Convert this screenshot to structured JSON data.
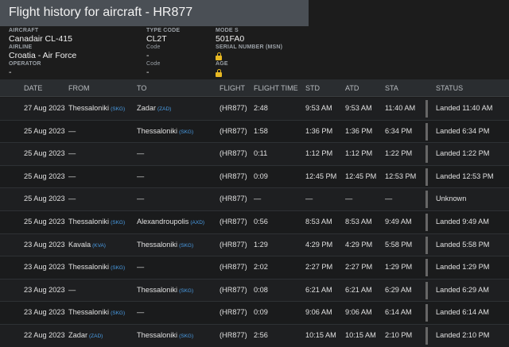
{
  "title": "Flight history for aircraft - HR877",
  "info": {
    "aircraft_label": "AIRCRAFT",
    "aircraft_value": "Canadair CL-415",
    "airline_label": "AIRLINE",
    "airline_value": "Croatia - Air Force",
    "operator_label": "OPERATOR",
    "operator_value": "-",
    "type_code_label": "TYPE CODE",
    "type_code_value": "CL2T",
    "code1_label": "Code",
    "code1_value": "-",
    "code2_label": "Code",
    "code2_value": "-",
    "mode_s_label": "MODE S",
    "mode_s_value": "501FA0",
    "msn_label": "SERIAL NUMBER (MSN)",
    "age_label": "AGE",
    "lock_icon": "lock-icon",
    "lock_color": "#e8b923"
  },
  "table": {
    "headers": {
      "date": "DATE",
      "from": "FROM",
      "to": "TO",
      "flight": "FLIGHT",
      "flight_time": "FLIGHT TIME",
      "std": "STD",
      "atd": "ATD",
      "sta": "STA",
      "status": "STATUS"
    },
    "rows": [
      {
        "date": "27 Aug 2023",
        "from": "Thessaloniki",
        "from_code": "(SKG)",
        "to": "Zadar",
        "to_code": "(ZAD)",
        "flight": "(HR877)",
        "flight_time": "2:48",
        "std": "9:53 AM",
        "atd": "9:53 AM",
        "sta": "11:40 AM",
        "status": "Landed 11:40 AM"
      },
      {
        "date": "25 Aug 2023",
        "from": "—",
        "from_code": "",
        "to": "Thessaloniki",
        "to_code": "(SKG)",
        "flight": "(HR877)",
        "flight_time": "1:58",
        "std": "1:36 PM",
        "atd": "1:36 PM",
        "sta": "6:34 PM",
        "status": "Landed 6:34 PM"
      },
      {
        "date": "25 Aug 2023",
        "from": "—",
        "from_code": "",
        "to": "—",
        "to_code": "",
        "flight": "(HR877)",
        "flight_time": "0:11",
        "std": "1:12 PM",
        "atd": "1:12 PM",
        "sta": "1:22 PM",
        "status": "Landed 1:22 PM"
      },
      {
        "date": "25 Aug 2023",
        "from": "—",
        "from_code": "",
        "to": "—",
        "to_code": "",
        "flight": "(HR877)",
        "flight_time": "0:09",
        "std": "12:45 PM",
        "atd": "12:45 PM",
        "sta": "12:53 PM",
        "status": "Landed 12:53 PM"
      },
      {
        "date": "25 Aug 2023",
        "from": "—",
        "from_code": "",
        "to": "—",
        "to_code": "",
        "flight": "(HR877)",
        "flight_time": "—",
        "std": "—",
        "atd": "—",
        "sta": "—",
        "status": "Unknown"
      },
      {
        "date": "25 Aug 2023",
        "from": "Thessaloniki",
        "from_code": "(SKG)",
        "to": "Alexandroupolis",
        "to_code": "(AXD)",
        "flight": "(HR877)",
        "flight_time": "0:56",
        "std": "8:53 AM",
        "atd": "8:53 AM",
        "sta": "9:49 AM",
        "status": "Landed 9:49 AM"
      },
      {
        "date": "23 Aug 2023",
        "from": "Kavala",
        "from_code": "(KVA)",
        "to": "Thessaloniki",
        "to_code": "(SKG)",
        "flight": "(HR877)",
        "flight_time": "1:29",
        "std": "4:29 PM",
        "atd": "4:29 PM",
        "sta": "5:58 PM",
        "status": "Landed 5:58 PM"
      },
      {
        "date": "23 Aug 2023",
        "from": "Thessaloniki",
        "from_code": "(SKG)",
        "to": "—",
        "to_code": "",
        "flight": "(HR877)",
        "flight_time": "2:02",
        "std": "2:27 PM",
        "atd": "2:27 PM",
        "sta": "1:29 PM",
        "status": "Landed 1:29 PM"
      },
      {
        "date": "23 Aug 2023",
        "from": "—",
        "from_code": "",
        "to": "Thessaloniki",
        "to_code": "(SKG)",
        "flight": "(HR877)",
        "flight_time": "0:08",
        "std": "6:21 AM",
        "atd": "6:21 AM",
        "sta": "6:29 AM",
        "status": "Landed 6:29 AM"
      },
      {
        "date": "23 Aug 2023",
        "from": "Thessaloniki",
        "from_code": "(SKG)",
        "to": "—",
        "to_code": "",
        "flight": "(HR877)",
        "flight_time": "0:09",
        "std": "9:06 AM",
        "atd": "9:06 AM",
        "sta": "6:14 AM",
        "status": "Landed 6:14 AM"
      },
      {
        "date": "22 Aug 2023",
        "from": "Zadar",
        "from_code": "(ZAD)",
        "to": "Thessaloniki",
        "to_code": "(SKG)",
        "flight": "(HR877)",
        "flight_time": "2:56",
        "std": "10:15 AM",
        "atd": "10:15 AM",
        "sta": "2:10 PM",
        "status": "Landed 2:10 PM"
      }
    ]
  },
  "colors": {
    "airport_code": "#4a9ee8",
    "status_bar": "#666666"
  }
}
